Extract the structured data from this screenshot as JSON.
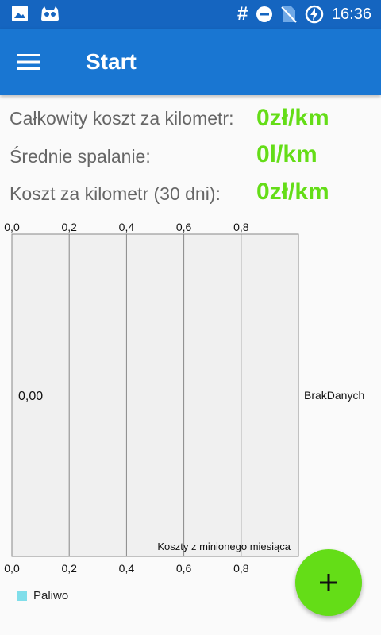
{
  "status_bar": {
    "time": "16:36",
    "hash_symbol": "#",
    "icons": [
      "image-icon",
      "notification-app-icon",
      "do-not-disturb-icon",
      "no-sim-icon",
      "battery-charging-icon"
    ]
  },
  "app_bar": {
    "title": "Start",
    "menu_icon": "hamburger-menu-icon",
    "background": "#1976d2",
    "status_background": "#1565c0"
  },
  "stats": [
    {
      "label": "Całkowity koszt za kilometr:",
      "value": "0zł/km"
    },
    {
      "label": "Średnie spalanie:",
      "value": "0l/km"
    },
    {
      "label": "Koszt za kilometr (30 dni):",
      "value": "0zł/km"
    }
  ],
  "accent_color": "#64dd17",
  "chart_data": {
    "type": "bar",
    "orientation": "horizontal",
    "categories": [
      "BrakDanych"
    ],
    "series": [
      {
        "name": "Paliwo",
        "values": [
          0
        ],
        "color": "#80deea"
      }
    ],
    "value_label": "0,00",
    "top_ticks": [
      "0,0",
      "0,2",
      "0,4",
      "0,6",
      "0,8"
    ],
    "bottom_ticks": [
      "0,0",
      "0,2",
      "0,4",
      "0,6",
      "0,8"
    ],
    "xlim": [
      0,
      1
    ],
    "description": "Koszty z minionego miesiąca",
    "grid": true,
    "legend_position": "bottom-left"
  },
  "fab": {
    "icon": "plus-icon",
    "color": "#64dd17"
  }
}
